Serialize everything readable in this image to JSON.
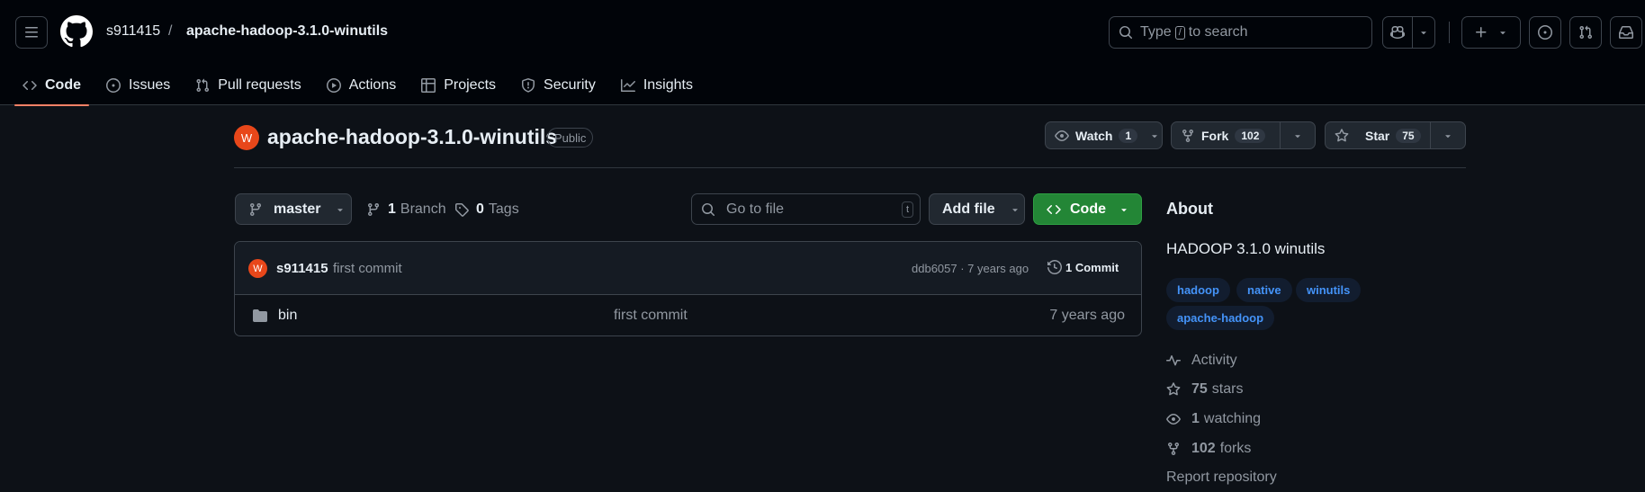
{
  "header": {
    "owner": "s911415",
    "separator": "/",
    "repo": "apache-hadoop-3.1.0-winutils",
    "search_prefix": "Type",
    "search_key": "/",
    "search_suffix": "to search"
  },
  "nav": {
    "code": "Code",
    "issues": "Issues",
    "pulls": "Pull requests",
    "actions": "Actions",
    "projects": "Projects",
    "security": "Security",
    "insights": "Insights"
  },
  "repo": {
    "avatar_letter": "W",
    "name": "apache-hadoop-3.1.0-winutils",
    "visibility": "Public",
    "watch_label": "Watch",
    "watch_count": "1",
    "fork_label": "Fork",
    "fork_count": "102",
    "star_label": "Star",
    "star_count": "75"
  },
  "toolbar": {
    "branch": "master",
    "branches_count": "1",
    "branches_label": "Branch",
    "tags_count": "0",
    "tags_label": "Tags",
    "goto_placeholder": "Go to file",
    "goto_key": "t",
    "add_file": "Add file",
    "code_button": "Code"
  },
  "commit": {
    "avatar_letter": "W",
    "author": "s911415",
    "message": "first commit",
    "hash_age": "ddb6057 · 7 years ago",
    "commits_label": "1 Commit"
  },
  "files": [
    {
      "name": "bin",
      "message": "first commit",
      "age": "7 years ago"
    }
  ],
  "about": {
    "title": "About",
    "description": "HADOOP 3.1.0 winutils",
    "topics": [
      "hadoop",
      "native",
      "winutils",
      "apache-hadoop"
    ],
    "activity": "Activity",
    "stars_count": "75",
    "stars_label": "stars",
    "watching_count": "1",
    "watching_label": "watching",
    "forks_count": "102",
    "forks_label": "forks",
    "report": "Report repository"
  },
  "colors": {
    "background": "#0d1117",
    "header_bg": "#010409",
    "accent_underline": "#f78166",
    "code_button_bg": "#238636",
    "topic_text": "#4493f8",
    "avatar_bg": "#e8471a"
  }
}
